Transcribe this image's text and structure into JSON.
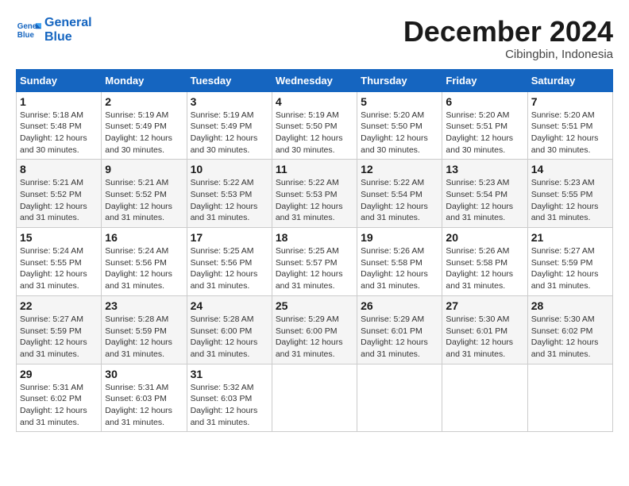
{
  "header": {
    "logo_line1": "General",
    "logo_line2": "Blue",
    "month": "December 2024",
    "location": "Cibingbin, Indonesia"
  },
  "days_of_week": [
    "Sunday",
    "Monday",
    "Tuesday",
    "Wednesday",
    "Thursday",
    "Friday",
    "Saturday"
  ],
  "weeks": [
    [
      {
        "num": "1",
        "rise": "5:18 AM",
        "set": "5:48 PM",
        "daylight": "12 hours and 30 minutes."
      },
      {
        "num": "2",
        "rise": "5:19 AM",
        "set": "5:49 PM",
        "daylight": "12 hours and 30 minutes."
      },
      {
        "num": "3",
        "rise": "5:19 AM",
        "set": "5:49 PM",
        "daylight": "12 hours and 30 minutes."
      },
      {
        "num": "4",
        "rise": "5:19 AM",
        "set": "5:50 PM",
        "daylight": "12 hours and 30 minutes."
      },
      {
        "num": "5",
        "rise": "5:20 AM",
        "set": "5:50 PM",
        "daylight": "12 hours and 30 minutes."
      },
      {
        "num": "6",
        "rise": "5:20 AM",
        "set": "5:51 PM",
        "daylight": "12 hours and 30 minutes."
      },
      {
        "num": "7",
        "rise": "5:20 AM",
        "set": "5:51 PM",
        "daylight": "12 hours and 30 minutes."
      }
    ],
    [
      {
        "num": "8",
        "rise": "5:21 AM",
        "set": "5:52 PM",
        "daylight": "12 hours and 31 minutes."
      },
      {
        "num": "9",
        "rise": "5:21 AM",
        "set": "5:52 PM",
        "daylight": "12 hours and 31 minutes."
      },
      {
        "num": "10",
        "rise": "5:22 AM",
        "set": "5:53 PM",
        "daylight": "12 hours and 31 minutes."
      },
      {
        "num": "11",
        "rise": "5:22 AM",
        "set": "5:53 PM",
        "daylight": "12 hours and 31 minutes."
      },
      {
        "num": "12",
        "rise": "5:22 AM",
        "set": "5:54 PM",
        "daylight": "12 hours and 31 minutes."
      },
      {
        "num": "13",
        "rise": "5:23 AM",
        "set": "5:54 PM",
        "daylight": "12 hours and 31 minutes."
      },
      {
        "num": "14",
        "rise": "5:23 AM",
        "set": "5:55 PM",
        "daylight": "12 hours and 31 minutes."
      }
    ],
    [
      {
        "num": "15",
        "rise": "5:24 AM",
        "set": "5:55 PM",
        "daylight": "12 hours and 31 minutes."
      },
      {
        "num": "16",
        "rise": "5:24 AM",
        "set": "5:56 PM",
        "daylight": "12 hours and 31 minutes."
      },
      {
        "num": "17",
        "rise": "5:25 AM",
        "set": "5:56 PM",
        "daylight": "12 hours and 31 minutes."
      },
      {
        "num": "18",
        "rise": "5:25 AM",
        "set": "5:57 PM",
        "daylight": "12 hours and 31 minutes."
      },
      {
        "num": "19",
        "rise": "5:26 AM",
        "set": "5:58 PM",
        "daylight": "12 hours and 31 minutes."
      },
      {
        "num": "20",
        "rise": "5:26 AM",
        "set": "5:58 PM",
        "daylight": "12 hours and 31 minutes."
      },
      {
        "num": "21",
        "rise": "5:27 AM",
        "set": "5:59 PM",
        "daylight": "12 hours and 31 minutes."
      }
    ],
    [
      {
        "num": "22",
        "rise": "5:27 AM",
        "set": "5:59 PM",
        "daylight": "12 hours and 31 minutes."
      },
      {
        "num": "23",
        "rise": "5:28 AM",
        "set": "5:59 PM",
        "daylight": "12 hours and 31 minutes."
      },
      {
        "num": "24",
        "rise": "5:28 AM",
        "set": "6:00 PM",
        "daylight": "12 hours and 31 minutes."
      },
      {
        "num": "25",
        "rise": "5:29 AM",
        "set": "6:00 PM",
        "daylight": "12 hours and 31 minutes."
      },
      {
        "num": "26",
        "rise": "5:29 AM",
        "set": "6:01 PM",
        "daylight": "12 hours and 31 minutes."
      },
      {
        "num": "27",
        "rise": "5:30 AM",
        "set": "6:01 PM",
        "daylight": "12 hours and 31 minutes."
      },
      {
        "num": "28",
        "rise": "5:30 AM",
        "set": "6:02 PM",
        "daylight": "12 hours and 31 minutes."
      }
    ],
    [
      {
        "num": "29",
        "rise": "5:31 AM",
        "set": "6:02 PM",
        "daylight": "12 hours and 31 minutes."
      },
      {
        "num": "30",
        "rise": "5:31 AM",
        "set": "6:03 PM",
        "daylight": "12 hours and 31 minutes."
      },
      {
        "num": "31",
        "rise": "5:32 AM",
        "set": "6:03 PM",
        "daylight": "12 hours and 31 minutes."
      },
      null,
      null,
      null,
      null
    ]
  ],
  "labels": {
    "sunrise": "Sunrise:",
    "sunset": "Sunset:",
    "daylight": "Daylight:"
  }
}
